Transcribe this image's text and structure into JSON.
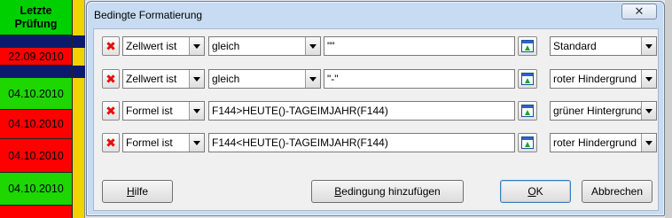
{
  "sheet": {
    "header_line1": "Letzte",
    "header_line2": "Prüfung",
    "cells": [
      {
        "text": "22.09.2010",
        "color": "red"
      },
      {
        "text": "04.10.2010",
        "color": "green"
      },
      {
        "text": "04.10.2010",
        "color": "red"
      },
      {
        "text": "04.10.2010",
        "color": "red"
      },
      {
        "text": "04.10.2010",
        "color": "green"
      }
    ]
  },
  "dialog": {
    "title": "Bedingte Formatierung",
    "close_glyph": "✕",
    "rows": [
      {
        "delete": "✖",
        "type": "Zellwert ist",
        "operator": "gleich",
        "value": "\"\"",
        "style": "Standard"
      },
      {
        "delete": "✖",
        "type": "Zellwert ist",
        "operator": "gleich",
        "value": "\"-\"",
        "style": "roter Hindergrund"
      },
      {
        "delete": "✖",
        "type": "Formel ist",
        "value": "F144>HEUTE()-TAGEIMJAHR(F144)",
        "style": "grüner Hintergrund"
      },
      {
        "delete": "✖",
        "type": "Formel ist",
        "value": "F144<HEUTE()-TAGEIMJAHR(F144)",
        "style": "roter Hindergrund"
      }
    ],
    "buttons": {
      "help_accel": "H",
      "help_rest": "ilfe",
      "add_accel": "B",
      "add_rest": "edingung hinzufügen",
      "ok_accel": "O",
      "ok_rest": "K",
      "cancel": "Abbrechen"
    }
  },
  "colors": {
    "red": "#ff0000",
    "green": "#1ed600",
    "navy": "#0a1a6e",
    "header_green": "#00d000",
    "yellow": "#f2d200"
  }
}
